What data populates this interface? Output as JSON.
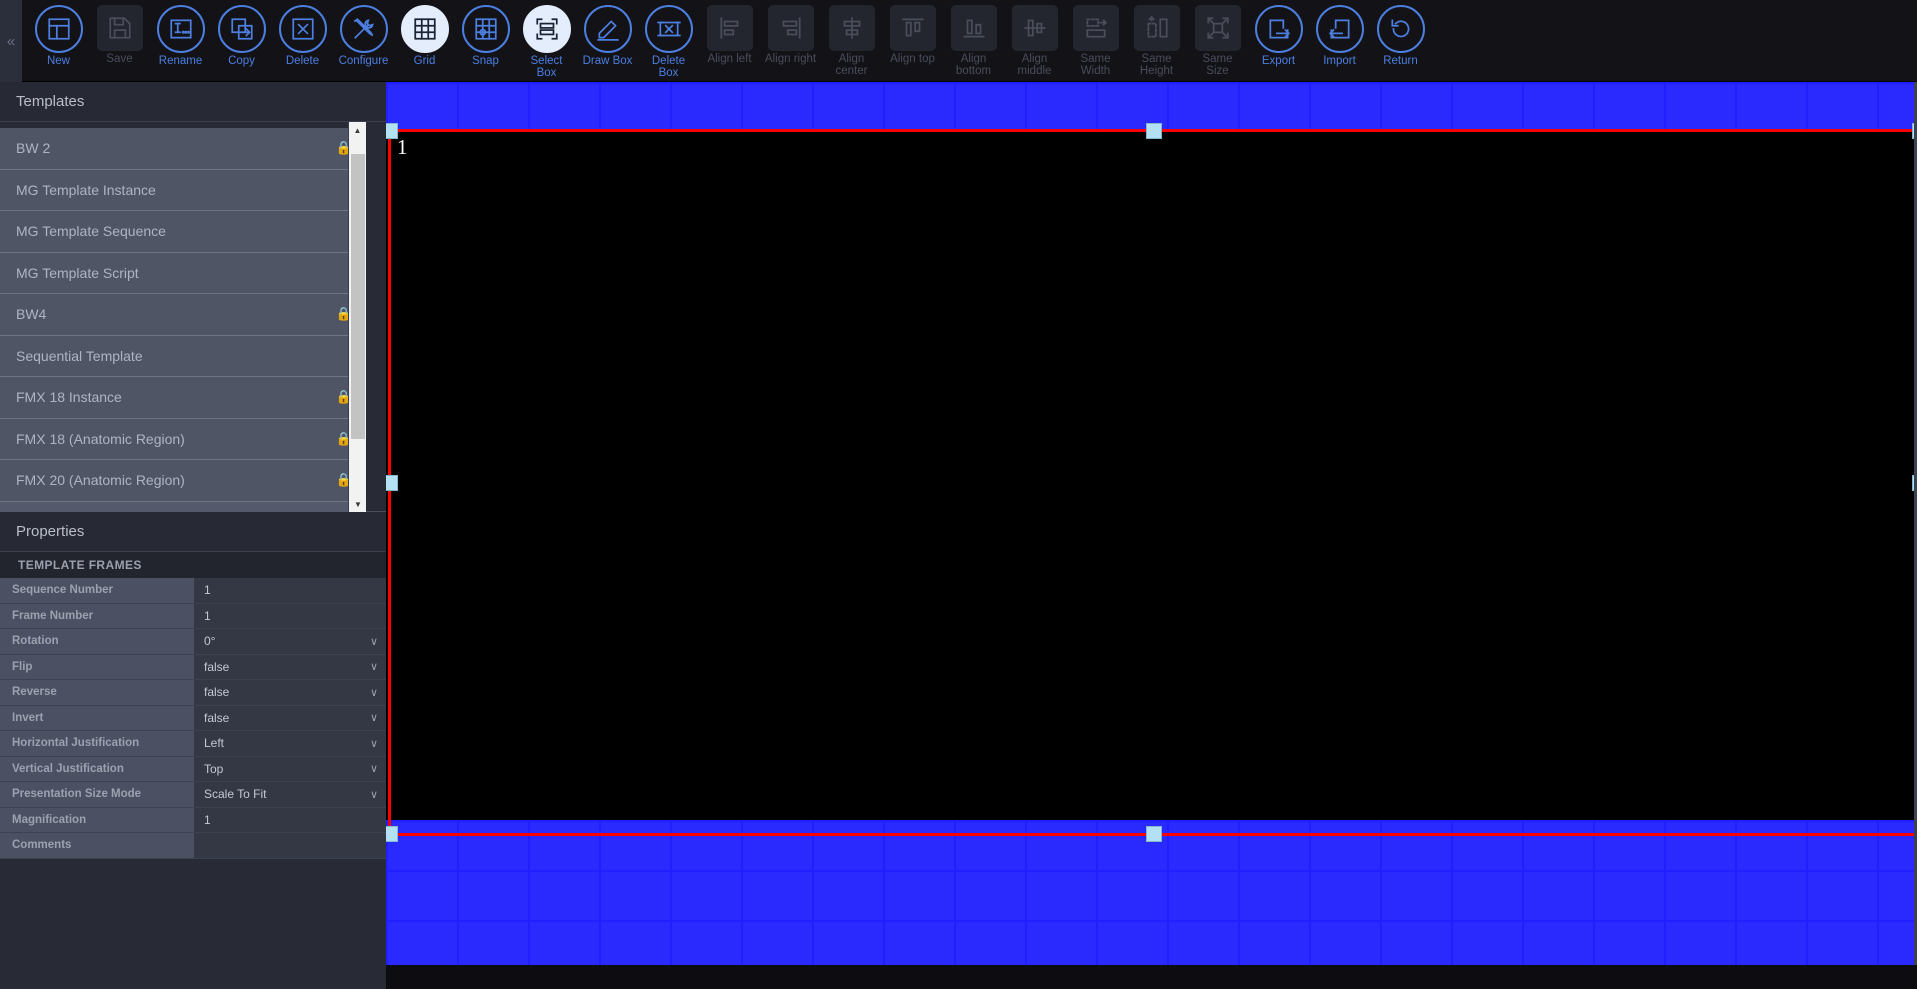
{
  "toolbar": {
    "collapse_label": "«",
    "tools": [
      {
        "label": "New",
        "icon": "layout-new-icon",
        "state": "normal",
        "interactable": true
      },
      {
        "label": "Save",
        "icon": "save-disk-icon",
        "state": "disabled",
        "interactable": false
      },
      {
        "label": "Rename",
        "icon": "rename-text-icon",
        "state": "normal",
        "interactable": true
      },
      {
        "label": "Copy",
        "icon": "copy-icon",
        "state": "normal",
        "interactable": true
      },
      {
        "label": "Delete",
        "icon": "delete-x-icon",
        "state": "normal",
        "interactable": true
      },
      {
        "label": "Configure",
        "icon": "tools-wrench-icon",
        "state": "normal",
        "interactable": true
      },
      {
        "label": "Grid",
        "icon": "grid-icon",
        "state": "active",
        "interactable": true
      },
      {
        "label": "Snap",
        "icon": "snap-grid-icon",
        "state": "normal",
        "interactable": true
      },
      {
        "label": "Select\nBox",
        "icon": "select-box-icon",
        "state": "active",
        "interactable": true
      },
      {
        "label": "Draw Box",
        "icon": "pencil-draw-icon",
        "state": "normal",
        "interactable": true
      },
      {
        "label": "Delete\nBox",
        "icon": "delete-box-icon",
        "state": "normal",
        "interactable": true
      },
      {
        "label": "Align left",
        "icon": "align-left-icon",
        "state": "disabled",
        "interactable": false
      },
      {
        "label": "Align right",
        "icon": "align-right-icon",
        "state": "disabled",
        "interactable": false
      },
      {
        "label": "Align\ncenter",
        "icon": "align-center-icon",
        "state": "disabled",
        "interactable": false
      },
      {
        "label": "Align top",
        "icon": "align-top-icon",
        "state": "disabled",
        "interactable": false
      },
      {
        "label": "Align\nbottom",
        "icon": "align-bottom-icon",
        "state": "disabled",
        "interactable": false
      },
      {
        "label": "Align\nmiddle",
        "icon": "align-middle-icon",
        "state": "disabled",
        "interactable": false
      },
      {
        "label": "Same\nWidth",
        "icon": "same-width-icon",
        "state": "disabled",
        "interactable": false
      },
      {
        "label": "Same\nHeight",
        "icon": "same-height-icon",
        "state": "disabled",
        "interactable": false
      },
      {
        "label": "Same\nSize",
        "icon": "same-size-icon",
        "state": "disabled",
        "interactable": false
      },
      {
        "label": "Export",
        "icon": "export-arrow-icon",
        "state": "normal",
        "interactable": true
      },
      {
        "label": "Import",
        "icon": "import-arrow-icon",
        "state": "normal",
        "interactable": true
      },
      {
        "label": "Return",
        "icon": "return-undo-icon",
        "state": "normal",
        "interactable": true
      }
    ]
  },
  "templates_panel": {
    "title": "Templates",
    "lock_glyph": "🔒",
    "scroll_up_glyph": "▲",
    "scroll_down_glyph": "▼",
    "items": [
      {
        "name": "BW 2",
        "locked": true
      },
      {
        "name": "MG Template Instance",
        "locked": false
      },
      {
        "name": "MG Template Sequence",
        "locked": false
      },
      {
        "name": "MG Template Script",
        "locked": false
      },
      {
        "name": "BW4",
        "locked": true
      },
      {
        "name": "Sequential Template",
        "locked": false
      },
      {
        "name": "FMX 18 Instance",
        "locked": true
      },
      {
        "name": "FMX 18 (Anatomic Region)",
        "locked": true
      },
      {
        "name": "FMX 20 (Anatomic Region)",
        "locked": true
      }
    ]
  },
  "properties_panel": {
    "title": "Properties",
    "section_label": "TEMPLATE FRAMES",
    "chevron_glyph": "∨",
    "rows": [
      {
        "key": "Sequence Number",
        "value": "1",
        "type": "text"
      },
      {
        "key": "Frame Number",
        "value": "1",
        "type": "text"
      },
      {
        "key": "Rotation",
        "value": "0°",
        "type": "select"
      },
      {
        "key": "Flip",
        "value": "false",
        "type": "select"
      },
      {
        "key": "Reverse",
        "value": "false",
        "type": "select"
      },
      {
        "key": "Invert",
        "value": "false",
        "type": "select"
      },
      {
        "key": "Horizontal Justification",
        "value": "Left",
        "type": "select"
      },
      {
        "key": "Vertical Justification",
        "value": "Top",
        "type": "select"
      },
      {
        "key": "Presentation Size Mode",
        "value": "Scale To Fit",
        "type": "select"
      },
      {
        "key": "Magnification",
        "value": "1",
        "type": "text"
      },
      {
        "key": "Comments",
        "value": "",
        "type": "text"
      }
    ]
  },
  "canvas": {
    "frame_label": "1",
    "selection_color": "#fc0000",
    "grid_color": "#1f1fff",
    "handle_color": "#b3e0f2",
    "background_color": "#000000"
  }
}
